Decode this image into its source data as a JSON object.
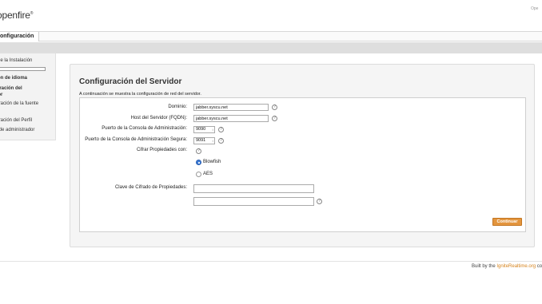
{
  "header": {
    "logo_text": "openfire",
    "logo_mark": "®",
    "right_text": "Ope"
  },
  "tabs": [
    {
      "label": "onfiguración"
    }
  ],
  "sidebar": {
    "items": [
      {
        "label": "o de la Instalación"
      },
      {
        "label": "ción de idioma"
      },
      {
        "label": "guración del",
        "label2": "idor"
      },
      {
        "label": "guración de la fuente",
        "label2": "tos"
      },
      {
        "label": "guración del Perfil"
      },
      {
        "label": "ta de administrador"
      }
    ]
  },
  "panel": {
    "title": "Configuración del Servidor",
    "description": "A continuación se muestra la configuración de red del servidor."
  },
  "form": {
    "domain_label": "Dominio:",
    "domain_value": "jabber.syscu.net",
    "fqdn_label": "Host del Servidor (FQDN):",
    "fqdn_value": "jabber.syscu.net",
    "admin_port_label": "Puerto de la Consola de Administración:",
    "admin_port_value": "9090",
    "secure_port_label": "Puerto de la Consola de Administración Segura:",
    "secure_port_value": "9091",
    "encrypt_label": "Cifrar Propiedades con:",
    "encrypt_options": [
      "Blowfish",
      "AES"
    ],
    "encrypt_selected": "Blowfish",
    "key_label": "Clave de Cifrado de Propiedades:",
    "key_value": "",
    "key_confirm_value": "",
    "help_glyph": "?",
    "spin_glyph": "↕"
  },
  "actions": {
    "continue_label": "Continuar"
  },
  "footer": {
    "prefix": "Built by the ",
    "link_text": "IgniteRealtime.org",
    "suffix": " co"
  },
  "colors": {
    "accent": "#e3953e",
    "link": "#d6831c",
    "radio_selected": "#3c7bd6"
  }
}
